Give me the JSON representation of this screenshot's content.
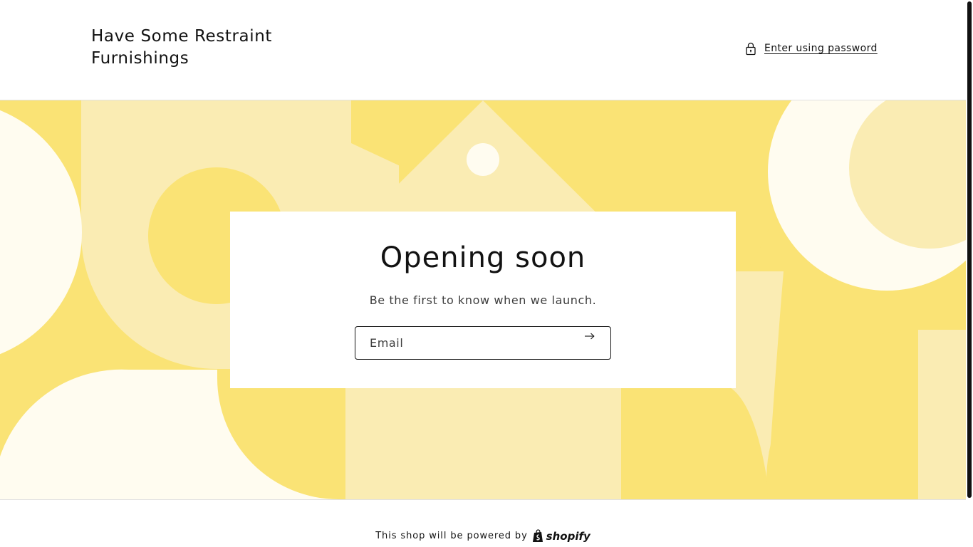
{
  "header": {
    "store_name": "Have Some Restraint Furnishings",
    "password_link": "Enter using password",
    "lock_icon": "lock-icon"
  },
  "hero": {
    "title": "Opening soon",
    "subtitle": "Be the first to know when we launch.",
    "email_placeholder": "Email",
    "submit_icon": "arrow-right-icon",
    "colors": {
      "dark_yellow": "#fae375",
      "light_yellow": "#faecb3",
      "cream": "#fffcf0"
    }
  },
  "footer": {
    "powered_text": "This shop will be powered by",
    "brand": "shopify"
  }
}
